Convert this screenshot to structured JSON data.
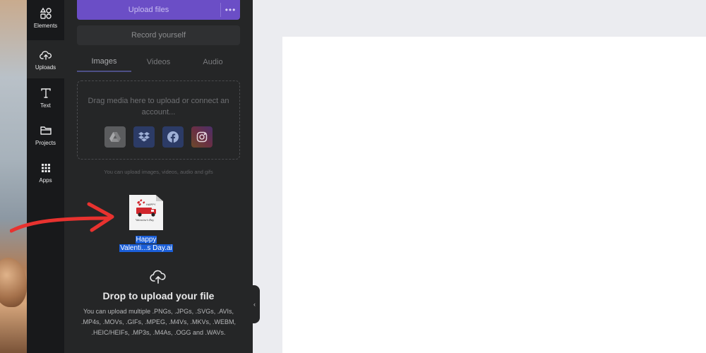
{
  "rail": {
    "items": [
      {
        "label": "Elements",
        "icon": "elements-icon"
      },
      {
        "label": "Uploads",
        "icon": "uploads-icon"
      },
      {
        "label": "Text",
        "icon": "text-icon"
      },
      {
        "label": "Projects",
        "icon": "folder-icon"
      },
      {
        "label": "Apps",
        "icon": "apps-grid-icon"
      }
    ],
    "active": "Uploads"
  },
  "panel": {
    "upload_label": "Upload files",
    "more_label": "•••",
    "record_label": "Record yourself",
    "tabs": [
      "Images",
      "Videos",
      "Audio"
    ],
    "active_tab": "Images",
    "dropzone_text": "Drag media here to upload or connect an account...",
    "services": [
      "google-drive-icon",
      "dropbox-icon",
      "facebook-icon",
      "instagram-icon"
    ],
    "hint": "You can upload images, videos, audio and gifs",
    "dragged_file": {
      "name_line1": "Happy",
      "name_line2": "Valenti...s Day.ai",
      "thumbnail_text_1": "HAPPY",
      "thumbnail_text_2": "Valentine's Day"
    },
    "drop_title": "Drop to upload your file",
    "drop_description": "You can upload multiple .PNGs, .JPGs, .SVGs, .AVIs, .MP4s, .MOVs, .GIFs, .MPEG, .M4Vs, .MKVs, .WEBM, .HEIC/HEIFs, .MP3s, .M4As, .OGG and .WAVs.",
    "collapse_icon": "‹"
  },
  "colors": {
    "accent": "#6b4ec6",
    "selection": "#1a5ed8",
    "annotation_arrow": "#e8322f"
  }
}
